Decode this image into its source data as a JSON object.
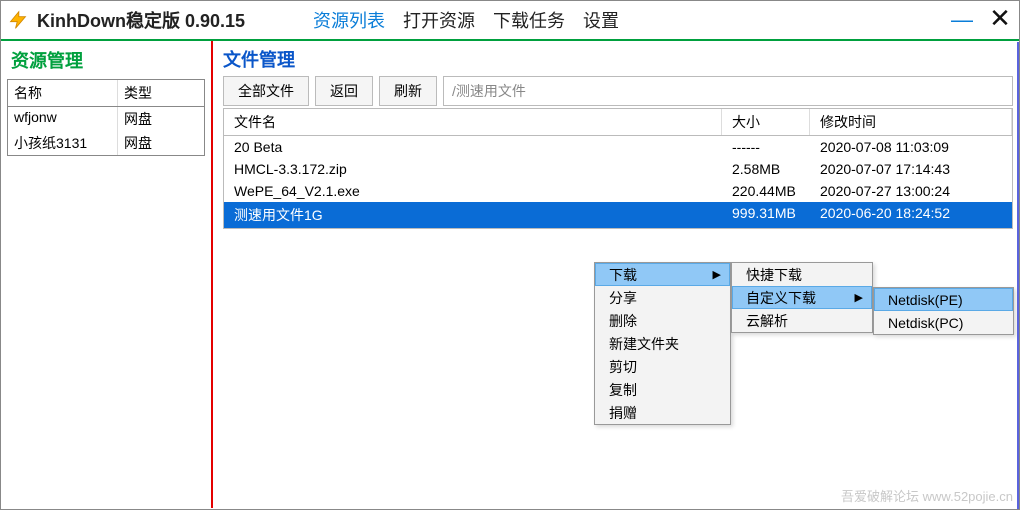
{
  "app_title": "KinhDown稳定版 0.90.15",
  "nav": {
    "items": [
      "资源列表",
      "打开资源",
      "下载任务",
      "设置"
    ],
    "active_index": 0
  },
  "sidebar": {
    "title": "资源管理",
    "cols": [
      "名称",
      "类型"
    ],
    "rows": [
      {
        "name": "wfjonw",
        "type": "网盘"
      },
      {
        "name": "小孩纸3131",
        "type": "网盘"
      }
    ]
  },
  "main": {
    "title": "文件管理",
    "toolbar": {
      "all": "全部文件",
      "back": "返回",
      "refresh": "刷新",
      "path": "/测速用文件"
    },
    "cols": {
      "name": "文件名",
      "size": "大小",
      "time": "修改时间"
    },
    "files": [
      {
        "name": "20 Beta",
        "size": "------",
        "time": "2020-07-08 11:03:09"
      },
      {
        "name": "HMCL-3.3.172.zip",
        "size": "2.58MB",
        "time": "2020-07-07 17:14:43"
      },
      {
        "name": "WePE_64_V2.1.exe",
        "size": "220.44MB",
        "time": "2020-07-27 13:00:24"
      },
      {
        "name": "测速用文件1G",
        "size": "999.31MB",
        "time": "2020-06-20 18:24:52"
      }
    ],
    "selected_index": 3
  },
  "context_menu": {
    "level1": [
      "下载",
      "分享",
      "删除",
      "新建文件夹",
      "剪切",
      "复制",
      "捐赠"
    ],
    "level1_hi": 0,
    "level2": [
      "快捷下载",
      "自定义下载",
      "云解析"
    ],
    "level2_hi": 1,
    "level3": [
      "Netdisk(PE)",
      "Netdisk(PC)"
    ],
    "level3_hi": 0
  },
  "watermark": "吾爱破解论坛  www.52pojie.cn"
}
